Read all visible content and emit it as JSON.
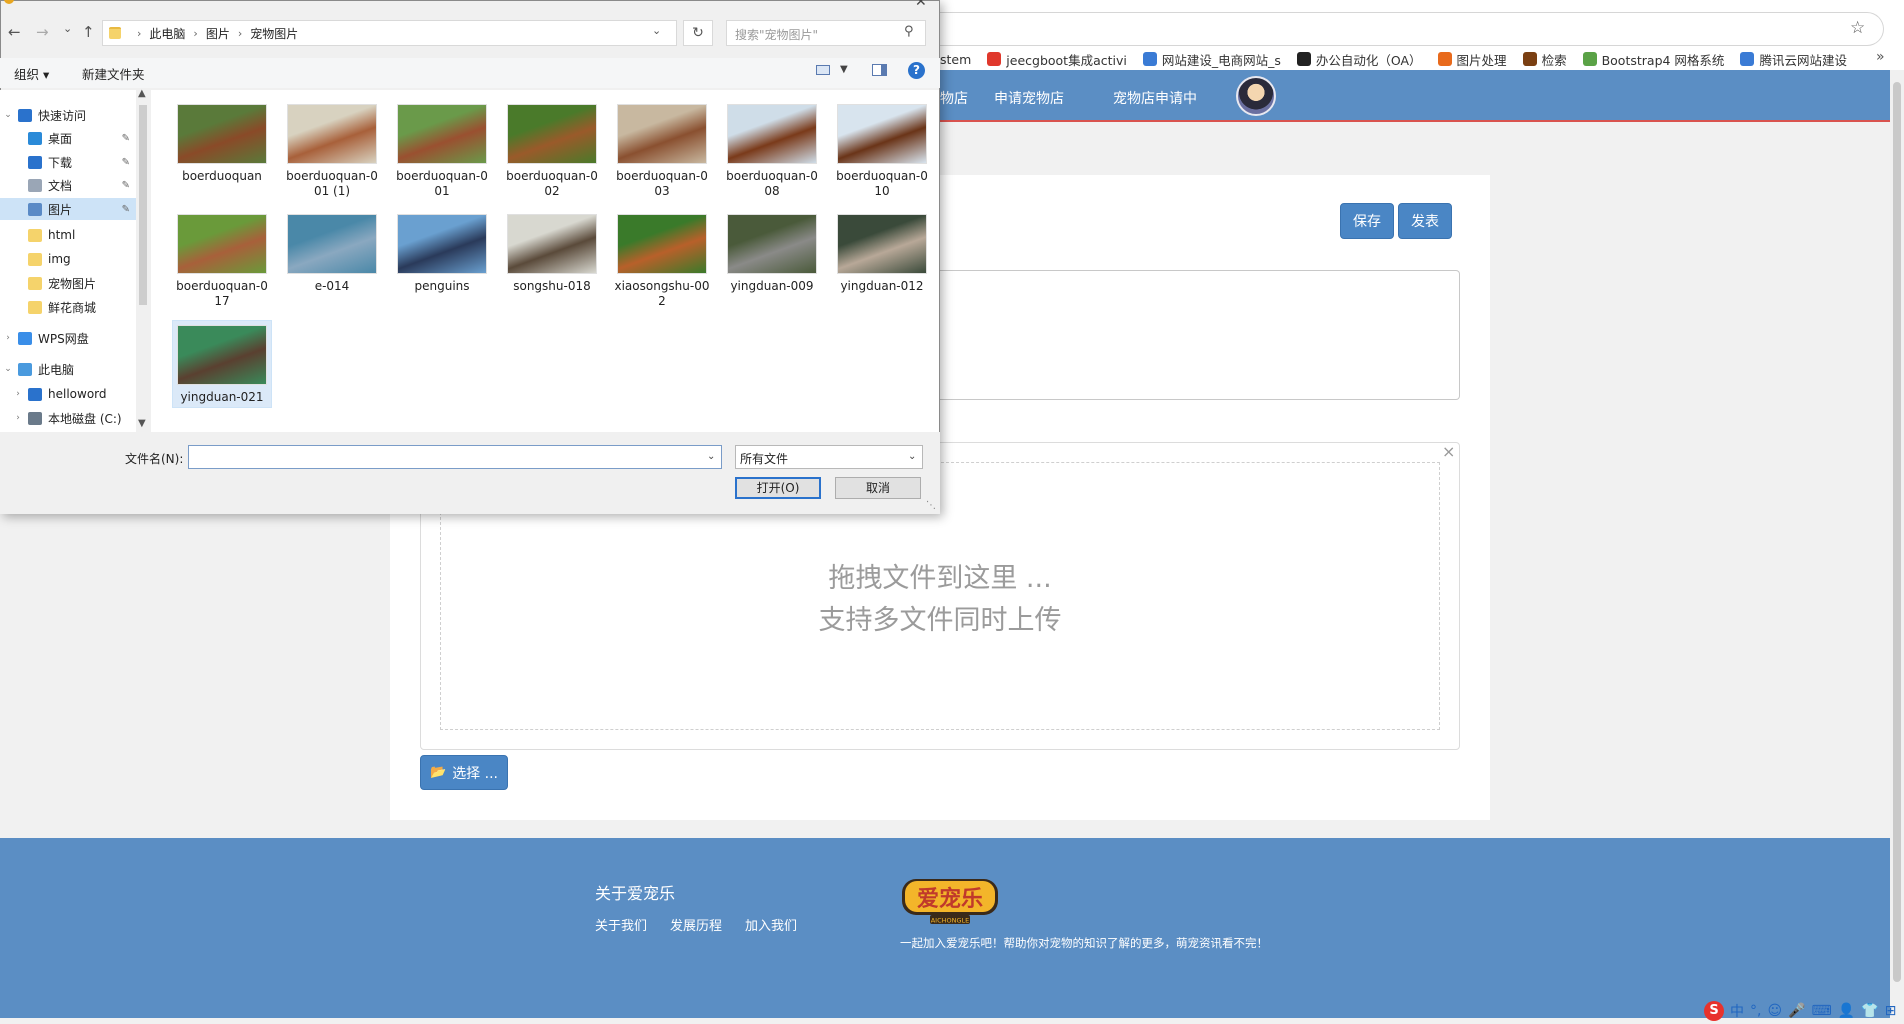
{
  "browser": {
    "bookmarks": [
      {
        "label": "stem",
        "color": ""
      },
      {
        "label": "jeecgboot集成activi",
        "color": "#e0382c"
      },
      {
        "label": "网站建设_电商网站_s",
        "color": "#3a7bd5"
      },
      {
        "label": "办公自动化（OA）",
        "color": "#222222"
      },
      {
        "label": "图片处理",
        "color": "#e86a1c"
      },
      {
        "label": "检索",
        "color": "#7a3f12"
      },
      {
        "label": "Bootstrap4 网格系统",
        "color": "#5aa246"
      },
      {
        "label": "腾讯云网站建设",
        "color": "#3a7bd5"
      }
    ],
    "more": "»",
    "star": "☆"
  },
  "site": {
    "nav": [
      "物店",
      "申请宠物店",
      "宠物店申请中"
    ],
    "save_label": "保存",
    "publish_label": "发表",
    "drop_line1": "拖拽文件到这里 ...",
    "drop_line2": "支持多文件同时上传",
    "choose_label": "选择 ...",
    "close_x": "×",
    "footer_title": "关于爱宠乐",
    "footer_links": [
      "关于我们",
      "发展历程",
      "加入我们"
    ],
    "logo_text": "爱宠乐",
    "logo_sub": "AICHONGLE",
    "footer_desc": "一起加入爱宠乐吧！帮助你对宠物的知识了解的更多，萌宠资讯看不完！"
  },
  "tray": [
    "S",
    "中",
    "°,",
    "☺",
    "🎤",
    "⌨",
    "👤",
    "👕",
    "⊞"
  ],
  "dialog": {
    "close": "✕",
    "nav_back": "←",
    "nav_forward": "→",
    "nav_recent": "⌄",
    "nav_up": "↑",
    "breadcrumb": [
      "此电脑",
      "图片",
      "宠物图片"
    ],
    "refresh": "↻",
    "search_placeholder": "搜索\"宠物图片\"",
    "toolbar": {
      "organize": "组织 ▾",
      "new_folder": "新建文件夹",
      "help": "?"
    },
    "nav_items": [
      {
        "label": "快速访问",
        "icon": "star-icon",
        "color": "#2a72cc",
        "arrow": "⌄",
        "pin": false,
        "indent": 0,
        "selected": false
      },
      {
        "label": "桌面",
        "icon": "desktop-icon",
        "color": "#2a8ad8",
        "arrow": "",
        "pin": true,
        "indent": 1,
        "selected": false
      },
      {
        "label": "下载",
        "icon": "download-icon",
        "color": "#2a72cc",
        "arrow": "",
        "pin": true,
        "indent": 1,
        "selected": false
      },
      {
        "label": "文档",
        "icon": "documents-icon",
        "color": "#9aa6b6",
        "arrow": "",
        "pin": true,
        "indent": 1,
        "selected": false
      },
      {
        "label": "图片",
        "icon": "pictures-icon",
        "color": "#5a8ac6",
        "arrow": "",
        "pin": true,
        "indent": 1,
        "selected": true
      },
      {
        "label": "html",
        "icon": "folder-icon",
        "color": "#f5d36b",
        "arrow": "",
        "pin": false,
        "indent": 1,
        "selected": false
      },
      {
        "label": "img",
        "icon": "folder-icon",
        "color": "#f5d36b",
        "arrow": "",
        "pin": false,
        "indent": 1,
        "selected": false
      },
      {
        "label": "宠物图片",
        "icon": "folder-icon",
        "color": "#f5d36b",
        "arrow": "",
        "pin": false,
        "indent": 1,
        "selected": false
      },
      {
        "label": "鲜花商城",
        "icon": "folder-icon",
        "color": "#f5d36b",
        "arrow": "",
        "pin": false,
        "indent": 1,
        "selected": false
      },
      {
        "label": "WPS网盘",
        "icon": "cloud-icon",
        "color": "#3a8ee8",
        "arrow": "›",
        "pin": false,
        "indent": 0,
        "selected": false
      },
      {
        "label": "此电脑",
        "icon": "computer-icon",
        "color": "#4a9ade",
        "arrow": "⌄",
        "pin": false,
        "indent": 0,
        "selected": false
      },
      {
        "label": "helloword",
        "icon": "drive-icon",
        "color": "#2a72cc",
        "arrow": "›",
        "pin": false,
        "indent": 1,
        "selected": false
      },
      {
        "label": "本地磁盘 (C:)",
        "icon": "disk-icon",
        "color": "#6a7a8a",
        "arrow": "›",
        "pin": false,
        "indent": 1,
        "selected": false
      }
    ],
    "files": [
      {
        "name": "boerduoquan",
        "thumb": [
          "#8a4a28",
          "#5a7a3a"
        ]
      },
      {
        "name": "boerduoquan-001 (1)",
        "thumb": [
          "#a8603a",
          "#d8d2c0"
        ]
      },
      {
        "name": "boerduoquan-001",
        "thumb": [
          "#9a5030",
          "#6a9a4a"
        ]
      },
      {
        "name": "boerduoquan-002",
        "thumb": [
          "#9a5a2a",
          "#4a7a2a"
        ]
      },
      {
        "name": "boerduoquan-003",
        "thumb": [
          "#8a5030",
          "#c8b8a0"
        ]
      },
      {
        "name": "boerduoquan-008",
        "thumb": [
          "#7a3a1a",
          "#cfdde8"
        ]
      },
      {
        "name": "boerduoquan-010",
        "thumb": [
          "#6a3418",
          "#d8e4ee"
        ]
      },
      {
        "name": "boerduoquan-017",
        "thumb": [
          "#a8603a",
          "#6a9a3a"
        ]
      },
      {
        "name": "e-014",
        "thumb": [
          "#8aa8c0",
          "#4a88a8"
        ]
      },
      {
        "name": "penguins",
        "thumb": [
          "#2a3a5a",
          "#6aa0d0"
        ]
      },
      {
        "name": "songshu-018",
        "thumb": [
          "#5a4a3a",
          "#d8d8d0"
        ]
      },
      {
        "name": "xiaosongshu-002",
        "thumb": [
          "#b8602a",
          "#3a7a2a"
        ]
      },
      {
        "name": "yingduan-009",
        "thumb": [
          "#8a8a88",
          "#4a5a3a"
        ]
      },
      {
        "name": "yingduan-012",
        "thumb": [
          "#b8a898",
          "#3a4a3a"
        ]
      },
      {
        "name": "yingduan-021",
        "thumb": [
          "#5a4030",
          "#3a8a5a"
        ]
      }
    ],
    "selected_file": "yingduan-021",
    "filename_label": "文件名(N):",
    "filename_value": "",
    "filter_value": "所有文件",
    "open_label": "打开(O)",
    "cancel_label": "取消"
  }
}
